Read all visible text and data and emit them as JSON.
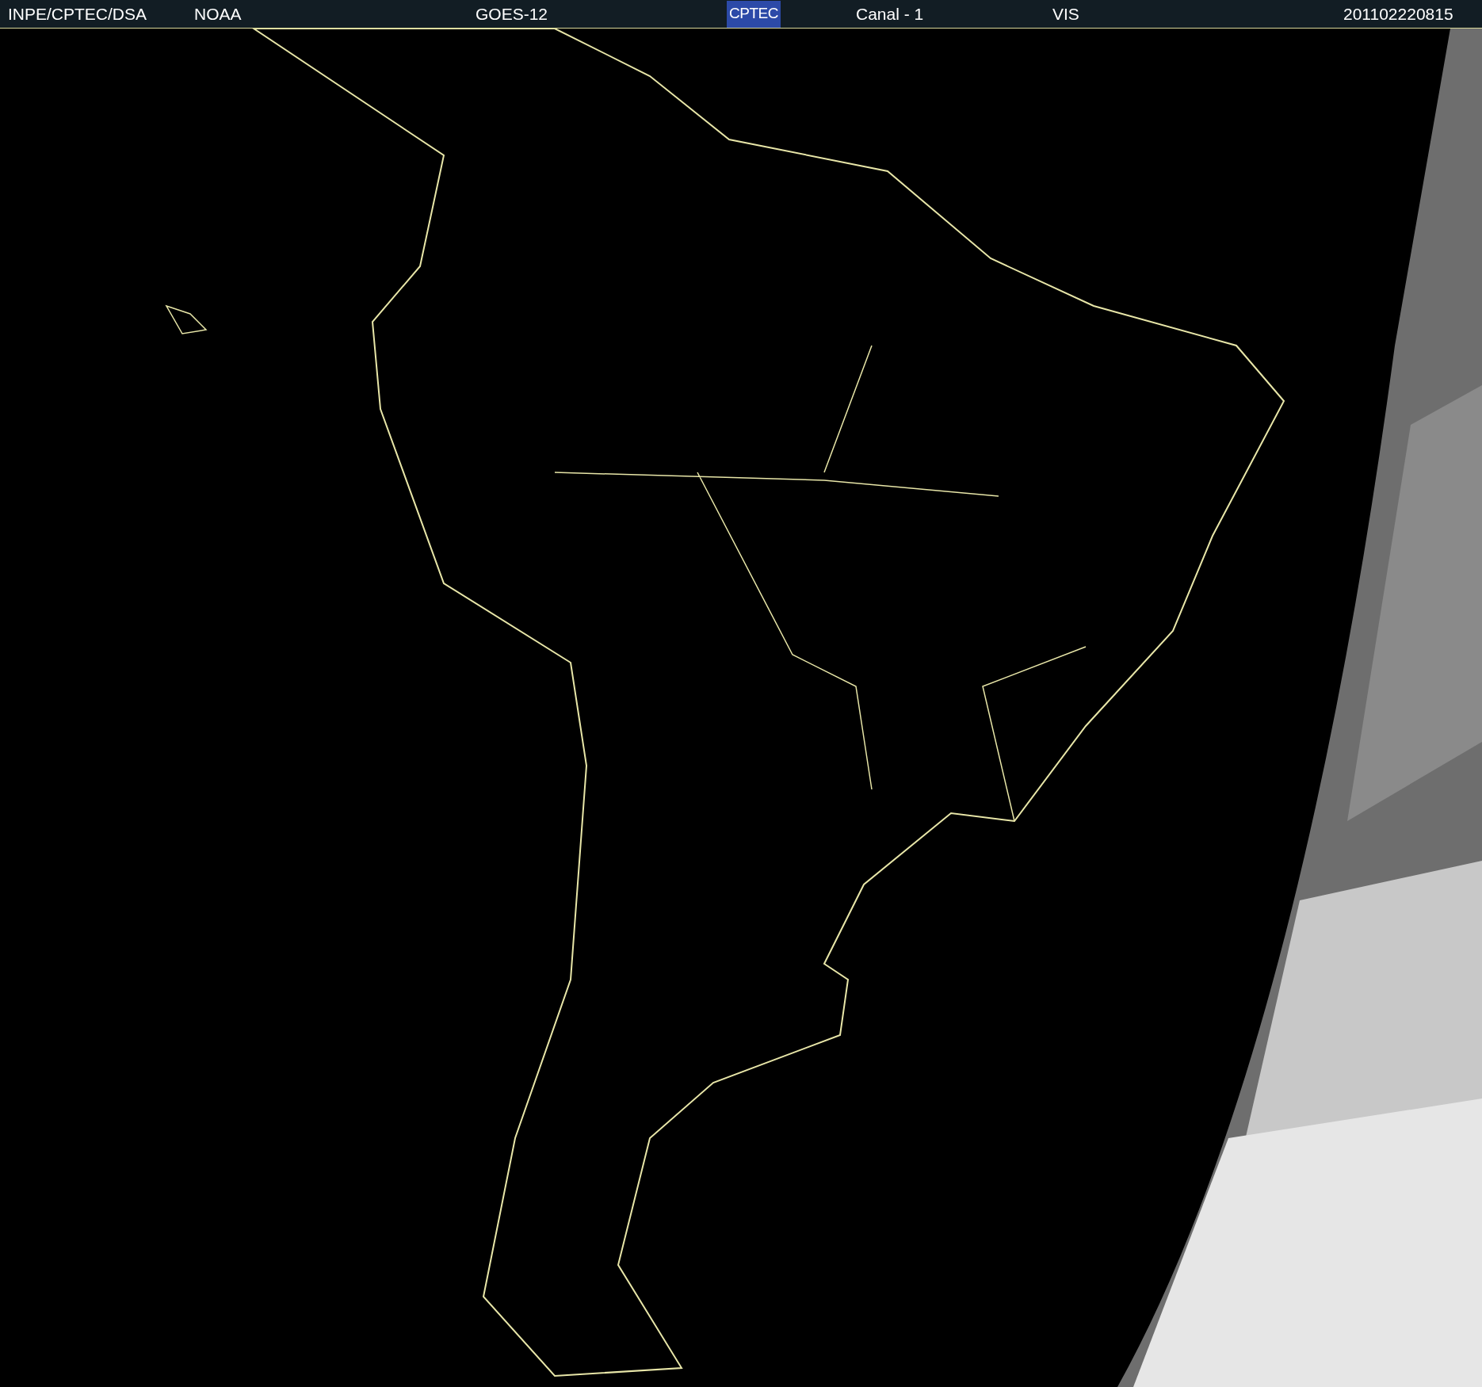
{
  "header": {
    "source": "INPE/CPTEC/DSA",
    "agency": "NOAA",
    "satellite": "GOES-12",
    "logo": "CPTEC",
    "channel": "Canal - 1",
    "band": "VIS",
    "timestamp": "201102220815"
  }
}
